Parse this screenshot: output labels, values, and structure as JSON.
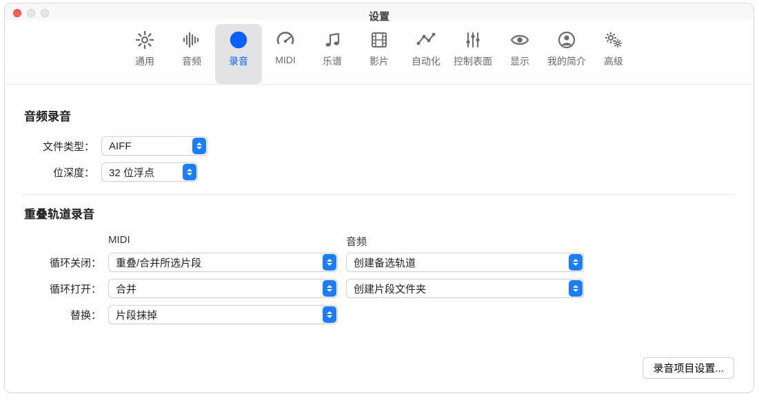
{
  "window": {
    "title": "设置"
  },
  "toolbar": {
    "items": [
      {
        "id": "general",
        "label": "通用",
        "icon": "gear"
      },
      {
        "id": "audio",
        "label": "音频",
        "icon": "waveform"
      },
      {
        "id": "record",
        "label": "录音",
        "icon": "record"
      },
      {
        "id": "midi",
        "label": "MIDI",
        "icon": "gauge"
      },
      {
        "id": "score",
        "label": "乐谱",
        "icon": "notes"
      },
      {
        "id": "movie",
        "label": "影片",
        "icon": "film"
      },
      {
        "id": "automation",
        "label": "自动化",
        "icon": "automation"
      },
      {
        "id": "surfaces",
        "label": "控制表面",
        "icon": "sliders"
      },
      {
        "id": "display",
        "label": "显示",
        "icon": "eye"
      },
      {
        "id": "myinfo",
        "label": "我的简介",
        "icon": "person"
      },
      {
        "id": "advanced",
        "label": "高级",
        "icon": "gears"
      }
    ],
    "active_index": 2
  },
  "sections": {
    "audio_recording": {
      "title": "音频录音",
      "file_type": {
        "label": "文件类型：",
        "value": "AIFF"
      },
      "bit_depth": {
        "label": "位深度：",
        "value": "32 位浮点"
      }
    },
    "overlap_recording": {
      "title": "重叠轨道录音",
      "col_midi": "MIDI",
      "col_audio": "音频",
      "rows": {
        "cycle_off": {
          "label": "循环关闭：",
          "midi": "重叠/合并所选片段",
          "audio": "创建备选轨道"
        },
        "cycle_on": {
          "label": "循环打开：",
          "midi": "合并",
          "audio": "创建片段文件夹"
        },
        "replace": {
          "label": "替换：",
          "midi": "片段抹掉"
        }
      }
    }
  },
  "footer": {
    "project_settings_button": "录音项目设置..."
  }
}
